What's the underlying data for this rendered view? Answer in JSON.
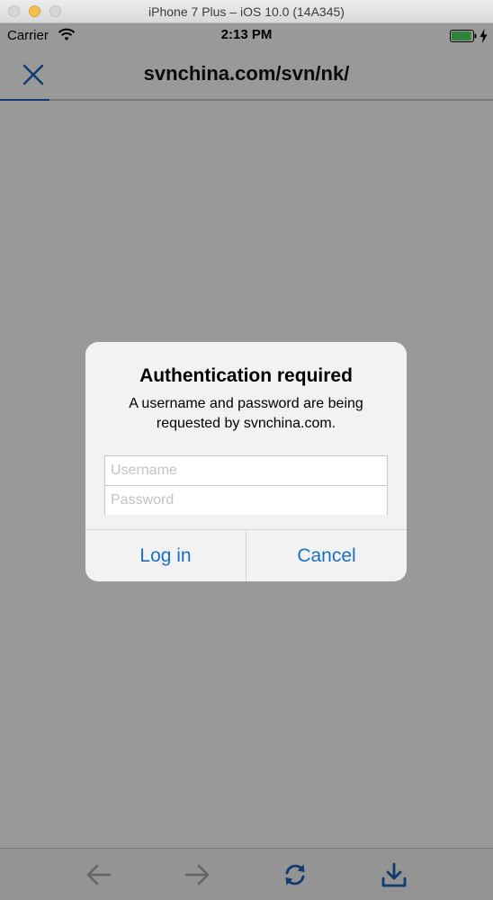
{
  "window": {
    "title": "iPhone 7 Plus – iOS 10.0 (14A345)"
  },
  "status_bar": {
    "carrier": "Carrier",
    "time": "2:13 PM",
    "battery_level": 0.95,
    "battery_color": "#4cd964"
  },
  "nav": {
    "title": "svnchina.com/svn/nk/",
    "progress": 0.1,
    "accent": "#1a63b8",
    "close_icon": "close-icon"
  },
  "toolbar": {
    "back_icon": "back-arrow-icon",
    "forward_icon": "forward-arrow-icon",
    "reload_icon": "reload-icon",
    "download_icon": "download-icon",
    "disabled_color": "#a8a8a8",
    "active_color": "#1a63b8"
  },
  "alert": {
    "title": "Authentication required",
    "message": "A username and password are being requested by svnchina.com.",
    "username_placeholder": "Username",
    "password_placeholder": "Password",
    "login_label": "Log in",
    "cancel_label": "Cancel",
    "button_color": "#1a6fc7"
  }
}
